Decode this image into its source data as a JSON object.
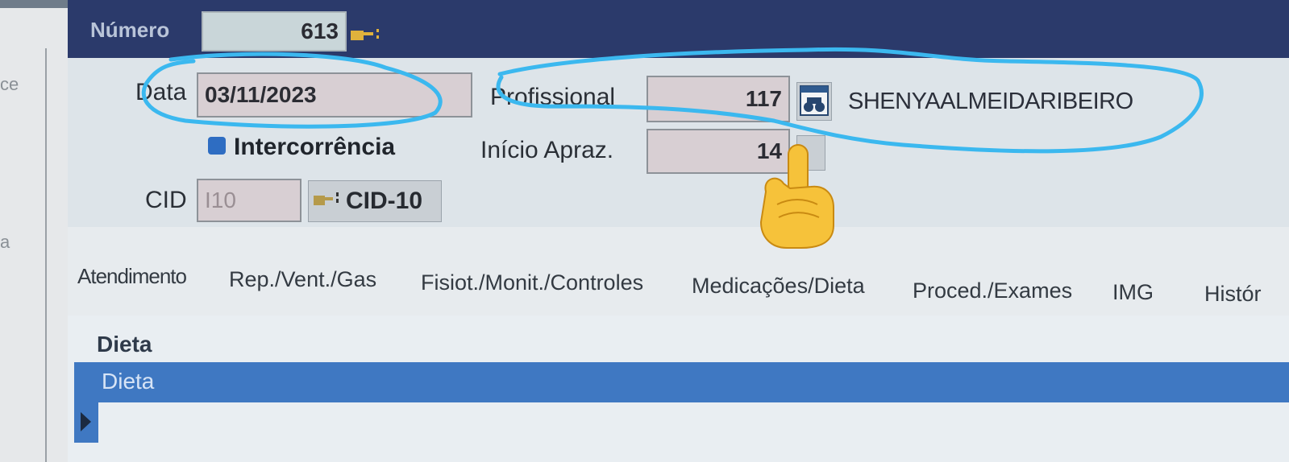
{
  "header": {
    "numero_label": "Número",
    "numero_value": "613"
  },
  "form": {
    "data_label": "Data",
    "data_value": "03/11/2023",
    "profissional_label": "Profissional",
    "profissional_code": "117",
    "profissional_name": "SHENYAALMEIDARIBEIRO",
    "intercorrencia_label": "Intercorrência",
    "inicio_apraz_label": "Início Apraz.",
    "inicio_apraz_value": "14",
    "cid_label": "CID",
    "cid_value": "I10",
    "cid10_button_label": "CID-10"
  },
  "left_fragments": [
    "ce",
    "a"
  ],
  "tabs": [
    {
      "label": "Atendimento"
    },
    {
      "label": "Rep./Vent./Gas"
    },
    {
      "label": "Fisiot./Monit./Controles"
    },
    {
      "label": "Medicações/Dieta"
    },
    {
      "label": "Proced./Exames"
    },
    {
      "label": "IMG"
    },
    {
      "label": "Histór"
    }
  ],
  "grid": {
    "header": "Dieta",
    "selected_row": "Dieta"
  },
  "icons": {
    "numero_lookup": "pointing-hand-icon",
    "profissional_lookup": "binoculars-calendar-icon",
    "cid_lookup": "pointing-hand-icon",
    "overlay_emoji": "pointing-up-emoji"
  },
  "colors": {
    "header_bg": "#2b3a6b",
    "selection_blue": "#3f78c2",
    "annotation_cyan": "#3bb8ef"
  }
}
